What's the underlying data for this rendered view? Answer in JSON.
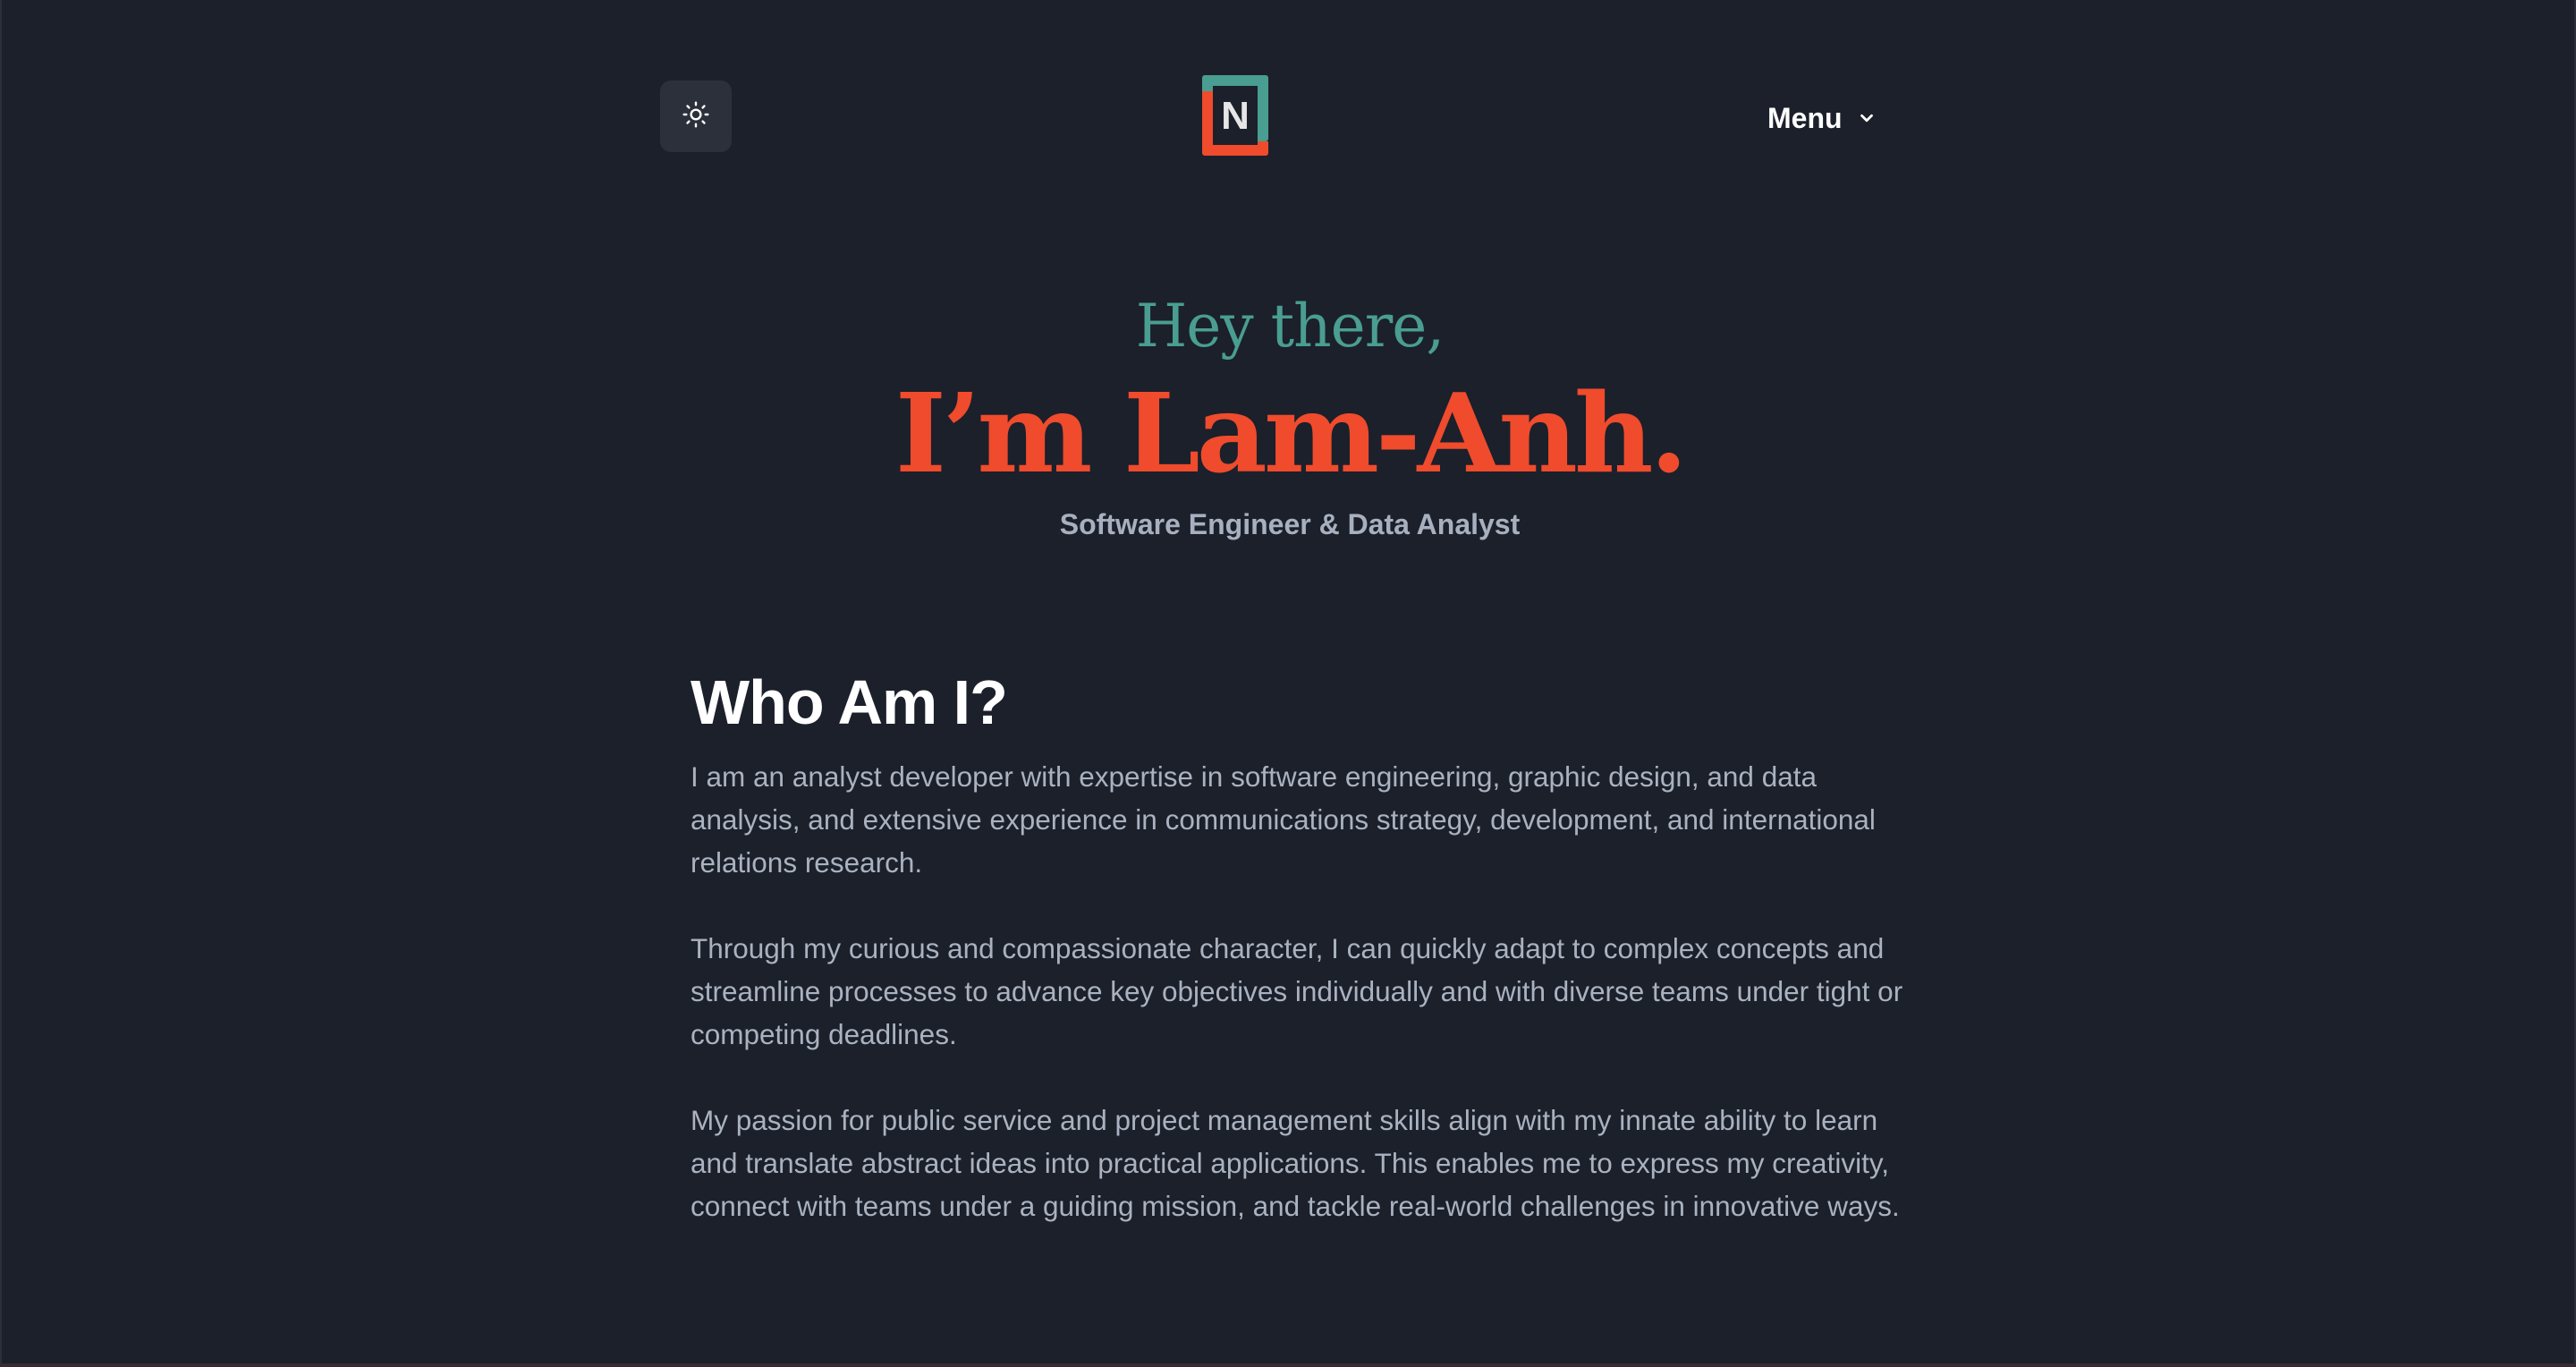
{
  "header": {
    "theme_toggle_icon": "sun-icon",
    "logo_letter": "N",
    "menu_label": "Menu",
    "menu_icon": "chevron-down-icon"
  },
  "hero": {
    "greeting": "Hey there,",
    "name": "I’m Lam-Anh.",
    "tagline": "Software Engineer & Data Analyst"
  },
  "about": {
    "heading": "Who Am I?",
    "paragraphs": [
      "I am an analyst developer with expertise in software engineering, graphic design, and data analysis, and extensive experience in communications strategy, development, and international relations research.",
      "Through my curious and compassionate character, I can quickly adapt to complex concepts and streamline processes to advance key objectives individually and with diverse teams under tight or competing deadlines.",
      "My passion for public service and project management skills align with my innate ability to learn and translate abstract ideas into practical applications. This enables me to express my creativity, connect with teams under a guiding mission, and tackle real-world challenges in innovative ways."
    ]
  },
  "colors": {
    "background": "#1b202b",
    "accent_teal": "#4a9d91",
    "accent_orange": "#ef4b2c",
    "body_text": "#aab2c0",
    "toggle_bg": "#2b303b"
  }
}
